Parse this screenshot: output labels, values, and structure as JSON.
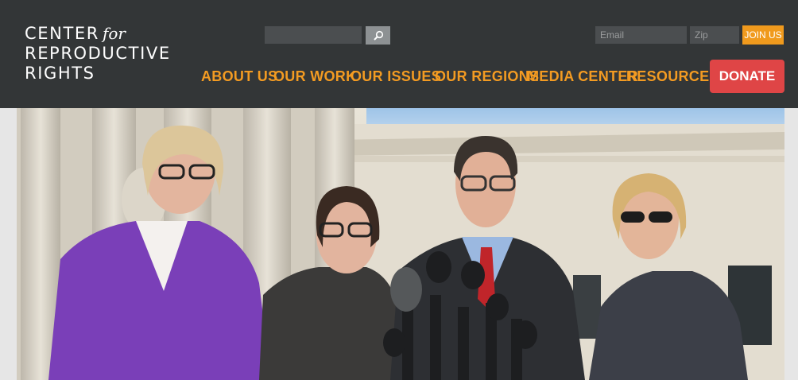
{
  "logo": {
    "line1": "CENTER",
    "for": "for",
    "line2": "REPRODUCTIVE",
    "line3": "RIGHTS"
  },
  "search": {
    "placeholder": ""
  },
  "newsletter": {
    "email_placeholder": "Email",
    "zip_placeholder": "Zip",
    "join_label": "JOIN US"
  },
  "nav": [
    "ABOUT US",
    "OUR WORK",
    "OUR ISSUES",
    "OUR REGIONS",
    "MEDIA CENTER",
    "RESOURCES"
  ],
  "donate_label": "DONATE",
  "colors": {
    "header_bg": "#333637",
    "nav_orange": "#f39b22",
    "donate_red": "#df4546",
    "join_orange": "#f09a1d"
  },
  "hero": {
    "description": "photo-people-at-press-conference"
  }
}
